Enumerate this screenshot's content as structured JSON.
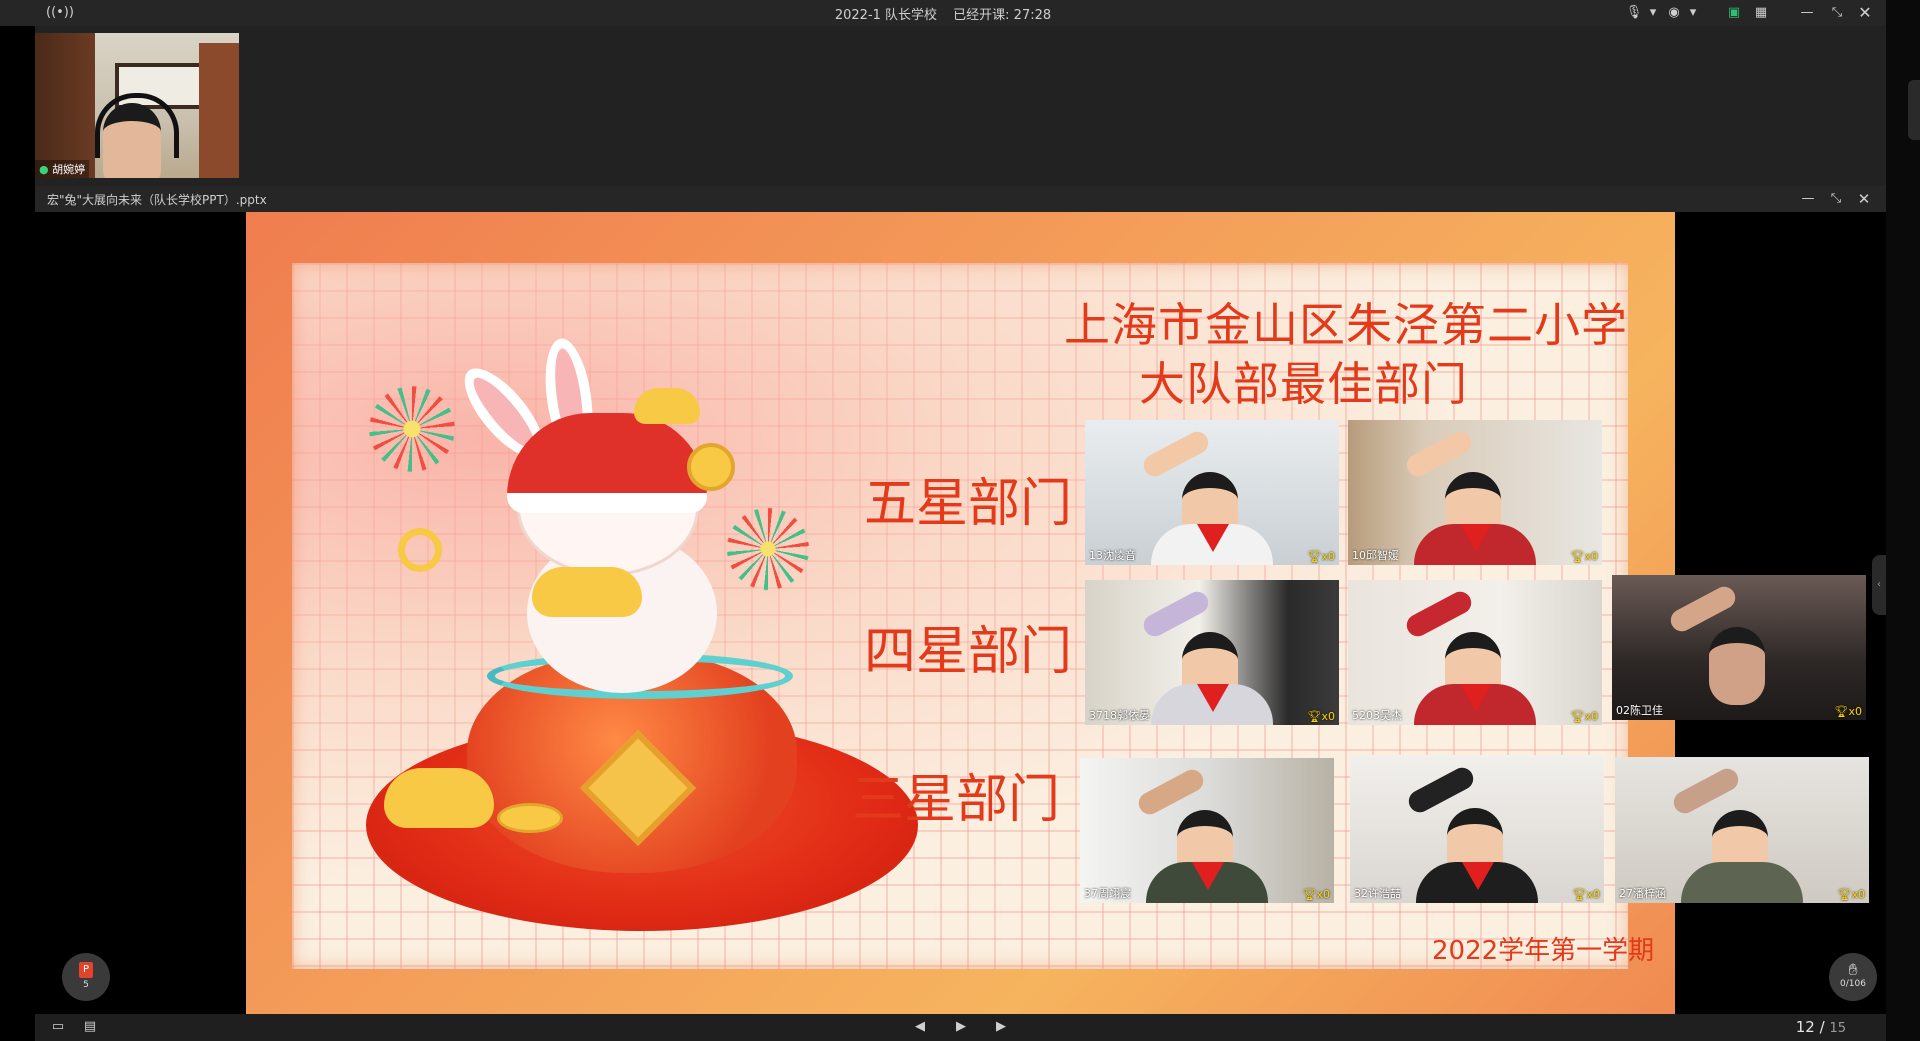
{
  "topbar": {
    "meeting_title": "2022-1 队长学校",
    "elapsed_label": "已经开课: 27:28",
    "icons": [
      "broadcast-icon",
      "microphone-icon",
      "camera-icon",
      "share-screen-icon",
      "grid-view-icon",
      "minimize-icon",
      "restore-icon",
      "close-icon"
    ]
  },
  "host": {
    "name": "胡婉婷"
  },
  "ppt": {
    "file_title": "宏\"兔\"大展向未来（队长学校PPT）.pptx",
    "current_page": "12",
    "page_sep": " / ",
    "total_pages": "15"
  },
  "slide": {
    "title_line1": "上海市金山区朱泾第二小学",
    "title_line2": "大队部最佳部门",
    "rank_five": "五星部门",
    "rank_four": "四星部门",
    "rank_three": "三星部门",
    "footer": "2022学年第一学期"
  },
  "participants": {
    "five_star": [
      {
        "name": "13沈凌音",
        "trophies": "x0"
      },
      {
        "name": "10邱智媛",
        "trophies": "x0"
      }
    ],
    "four_star": [
      {
        "name": "3718郭依晏",
        "trophies": "x0"
      },
      {
        "name": "5203吴杰",
        "trophies": "x0"
      },
      {
        "name": "02陈卫佳",
        "trophies": "x0"
      }
    ],
    "three_star": [
      {
        "name": "37周翊宸",
        "trophies": "x0"
      },
      {
        "name": "32许浩喆",
        "trophies": "x0"
      },
      {
        "name": "27潘梓涵",
        "trophies": "x0"
      }
    ]
  },
  "floating": {
    "ppt_badge_letter": "P",
    "ppt_badge_count": "5",
    "counter_value": "0/106"
  },
  "colors": {
    "slide_red": "#e23a1a",
    "trophy_gold": "#ffd400",
    "chrome_dark": "#262626"
  }
}
